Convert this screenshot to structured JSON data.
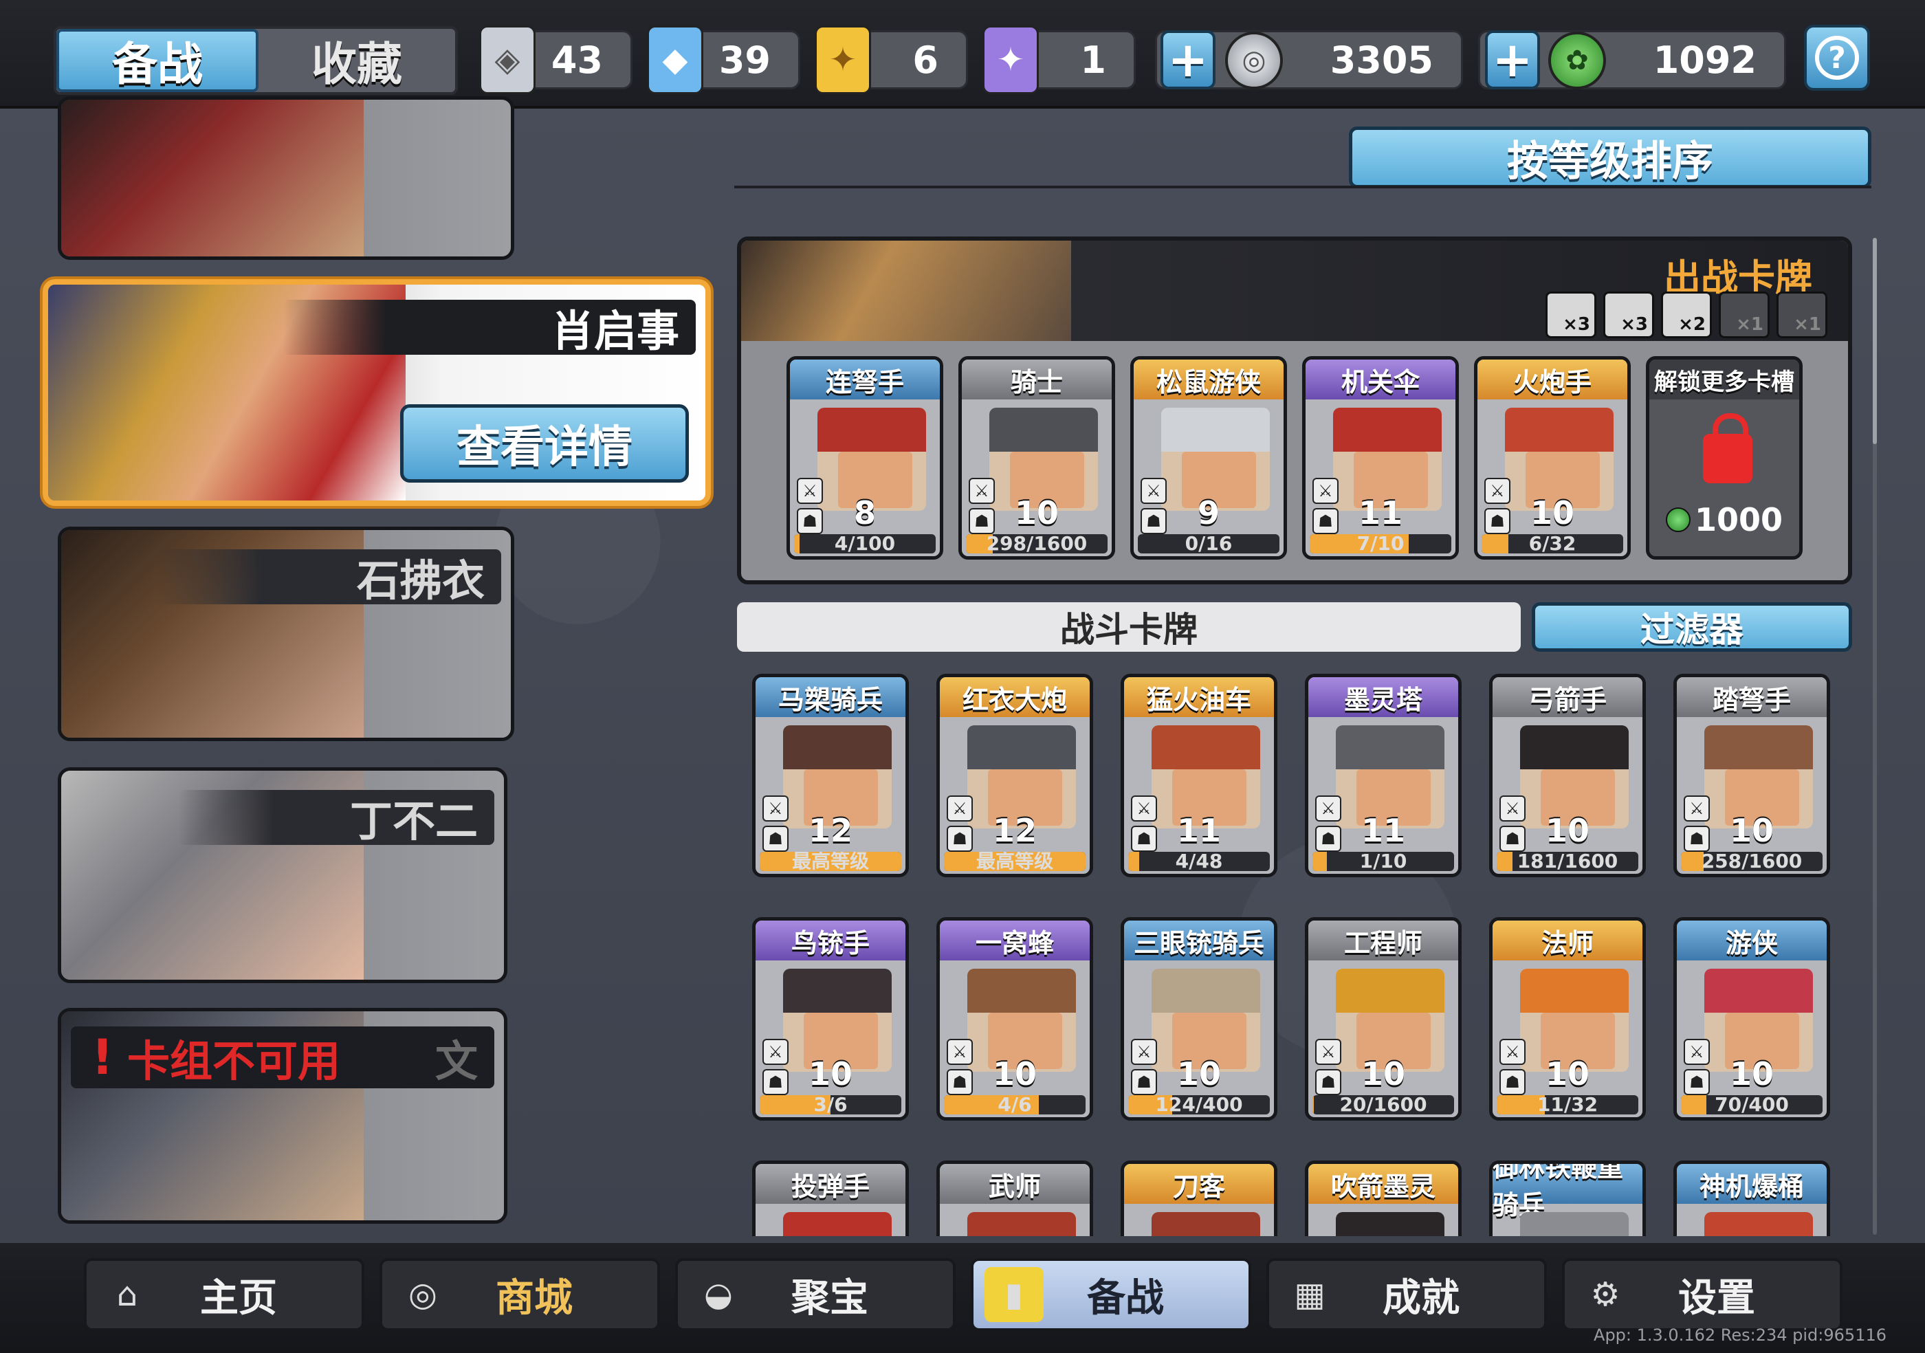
{
  "topbar": {
    "tabs": [
      {
        "label": "备战",
        "active": true
      },
      {
        "label": "收藏",
        "active": false
      }
    ],
    "resources": [
      {
        "name": "silver-scroll-icon",
        "value": "43",
        "color": "#d8dce2"
      },
      {
        "name": "blue-crystal-icon",
        "value": "39",
        "color": "#6fb8ef"
      },
      {
        "name": "gold-badge-icon",
        "value": "6",
        "color": "#f2c23a"
      },
      {
        "name": "purple-badge-icon",
        "value": "1",
        "color": "#9a7be0"
      }
    ],
    "silver_coins": "3305",
    "green_gems": "1092"
  },
  "heroes": [
    {
      "name": "",
      "state": "partial"
    },
    {
      "name": "肖启事",
      "state": "selected",
      "button": "查看详情"
    },
    {
      "name": "石拂衣",
      "state": "normal"
    },
    {
      "name": "丁不二",
      "state": "normal"
    },
    {
      "name": "文",
      "state": "unavailable",
      "warning": "卡组不可用"
    }
  ],
  "sort_button": "按等级排序",
  "deck": {
    "title": "出战卡牌",
    "type_counts": [
      {
        "icon": "sword-icon",
        "label": "×3"
      },
      {
        "icon": "helmet-icon",
        "label": "×3"
      },
      {
        "icon": "skull-icon",
        "label": "×2"
      },
      {
        "icon": "blade-icon",
        "label": "×1"
      },
      {
        "icon": "shield-icon",
        "label": "×1"
      }
    ],
    "cards": [
      {
        "name": "连弩手",
        "level": "8",
        "progress": "4/100",
        "fill": 0.04,
        "rarity": "blue",
        "cap": "#b2322a"
      },
      {
        "name": "骑士",
        "level": "10",
        "progress": "298/1600",
        "fill": 0.19,
        "rarity": "gray",
        "cap": "#4f5055"
      },
      {
        "name": "松鼠游侠",
        "level": "9",
        "progress": "0/16",
        "fill": 0.0,
        "rarity": "gold",
        "cap": "#cfd3d8"
      },
      {
        "name": "机关伞",
        "level": "11",
        "progress": "7/10",
        "fill": 0.7,
        "rarity": "purple",
        "cap": "#b8322a"
      },
      {
        "name": "火炮手",
        "level": "10",
        "progress": "6/32",
        "fill": 0.19,
        "rarity": "gold",
        "cap": "#c2452f"
      }
    ],
    "locked_slot": {
      "label": "解锁更多卡槽",
      "cost": "1000"
    }
  },
  "battle_cards_title": "战斗卡牌",
  "filter_button": "过滤器",
  "battle_cards": [
    {
      "name": "马槊骑兵",
      "level": "12",
      "progress": "最高等级",
      "fill": 1.0,
      "rarity": "blue",
      "cap": "#5a3a30"
    },
    {
      "name": "红衣大炮",
      "level": "12",
      "progress": "最高等级",
      "fill": 1.0,
      "rarity": "gold",
      "cap": "#50525a"
    },
    {
      "name": "猛火油车",
      "level": "11",
      "progress": "4/48",
      "fill": 0.08,
      "rarity": "gold",
      "cap": "#b24a2e"
    },
    {
      "name": "墨灵塔",
      "level": "11",
      "progress": "1/10",
      "fill": 0.1,
      "rarity": "purple",
      "cap": "#5c5e64"
    },
    {
      "name": "弓箭手",
      "level": "10",
      "progress": "181/1600",
      "fill": 0.11,
      "rarity": "gray",
      "cap": "#2a2526"
    },
    {
      "name": "踏弩手",
      "level": "10",
      "progress": "258/1600",
      "fill": 0.16,
      "rarity": "gray",
      "cap": "#8a5a40"
    },
    {
      "name": "鸟铳手",
      "level": "10",
      "progress": "3/6",
      "fill": 0.5,
      "rarity": "purple",
      "cap": "#3a3234"
    },
    {
      "name": "一窝蜂",
      "level": "10",
      "progress": "4/6",
      "fill": 0.67,
      "rarity": "purple",
      "cap": "#8a5a3a"
    },
    {
      "name": "三眼铳骑兵",
      "level": "10",
      "progress": "124/400",
      "fill": 0.31,
      "rarity": "blue",
      "cap": "#b5a48a"
    },
    {
      "name": "工程师",
      "level": "10",
      "progress": "20/1600",
      "fill": 0.01,
      "rarity": "gray",
      "cap": "#d99a2a"
    },
    {
      "name": "法师",
      "level": "10",
      "progress": "11/32",
      "fill": 0.34,
      "rarity": "gold",
      "cap": "#e07a2a"
    },
    {
      "name": "游侠",
      "level": "10",
      "progress": "70/400",
      "fill": 0.18,
      "rarity": "blue",
      "cap": "#c23a4a"
    },
    {
      "name": "投弹手",
      "level": "",
      "progress": "",
      "fill": 0,
      "rarity": "gray",
      "cap": "#b8322a"
    },
    {
      "name": "武师",
      "level": "",
      "progress": "",
      "fill": 0,
      "rarity": "gray",
      "cap": "#a83a2a"
    },
    {
      "name": "刀客",
      "level": "",
      "progress": "",
      "fill": 0,
      "rarity": "gold",
      "cap": "#9a3a2a"
    },
    {
      "name": "吹箭墨灵",
      "level": "",
      "progress": "",
      "fill": 0,
      "rarity": "gold",
      "cap": "#2a2526"
    },
    {
      "name": "御林铁鞭重骑兵",
      "level": "",
      "progress": "",
      "fill": 0,
      "rarity": "blue",
      "cap": "#8a8c92"
    },
    {
      "name": "神机爆桶",
      "level": "",
      "progress": "",
      "fill": 0,
      "rarity": "blue",
      "cap": "#c2452f"
    }
  ],
  "bottom_nav": [
    {
      "label": "主页",
      "icon": "home-icon",
      "active": false,
      "gold": false
    },
    {
      "label": "商城",
      "icon": "coins-icon",
      "active": false,
      "gold": true
    },
    {
      "label": "聚宝",
      "icon": "treasure-bowl-icon",
      "active": false,
      "gold": false
    },
    {
      "label": "备战",
      "icon": "card-deck-icon",
      "active": true,
      "gold": false
    },
    {
      "label": "成就",
      "icon": "achievements-icon",
      "active": false,
      "gold": false
    },
    {
      "label": "设置",
      "icon": "gear-icon",
      "active": false,
      "gold": false
    }
  ],
  "footer": "App: 1.3.0.162 Res:234 pid:965116"
}
